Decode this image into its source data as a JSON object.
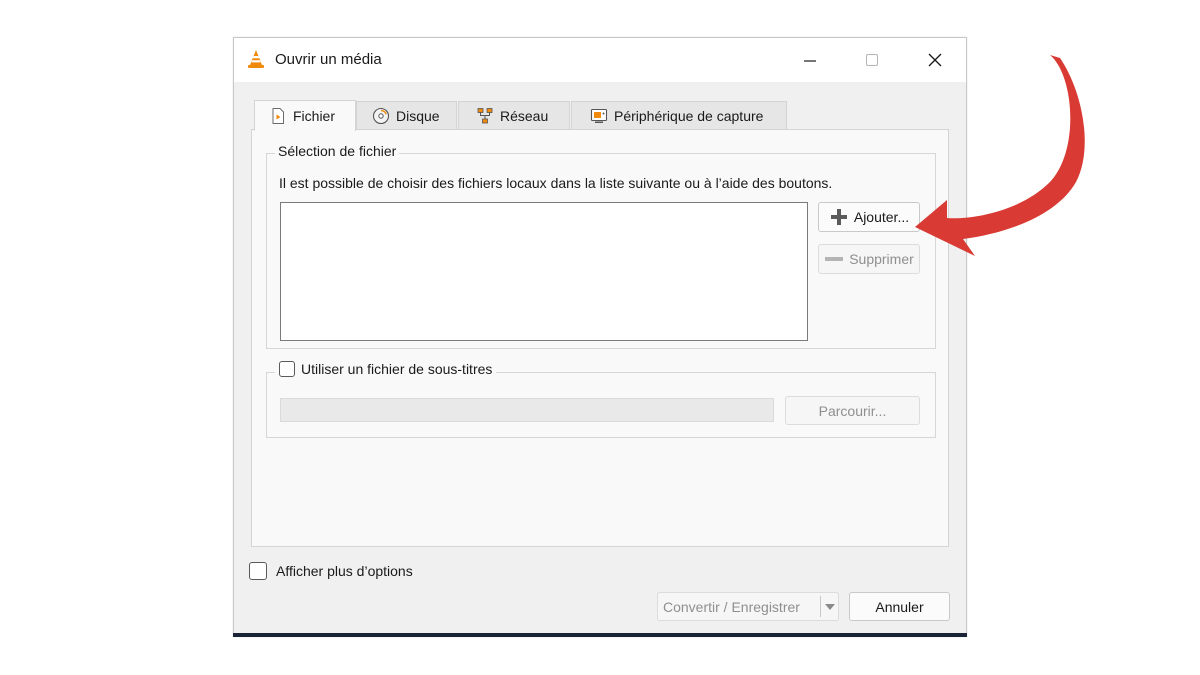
{
  "window": {
    "title": "Ouvrir un média",
    "minimize_symbol": "—",
    "maximize_symbol": "☐",
    "close_symbol": "✕"
  },
  "tabs": [
    {
      "label": "Fichier",
      "icon": "file-play-icon",
      "active": true
    },
    {
      "label": "Disque",
      "icon": "disc-icon",
      "active": false
    },
    {
      "label": "Réseau",
      "icon": "network-icon",
      "active": false
    },
    {
      "label": "Périphérique de capture",
      "icon": "capture-device-icon",
      "active": false
    }
  ],
  "file_selection": {
    "group_title": "Sélection de fichier",
    "description": "Il est possible de choisir des fichiers locaux dans la liste suivante ou à l’aide des boutons.",
    "add_label": "Ajouter...",
    "remove_label": "Supprimer"
  },
  "subtitles": {
    "checkbox_label": "Utiliser un fichier de sous-titres",
    "checked": false,
    "browse_label": "Parcourir..."
  },
  "footer": {
    "more_options_label": "Afficher plus d’options",
    "more_options_checked": false,
    "convert_label": "Convertir / Enregistrer",
    "cancel_label": "Annuler"
  },
  "annotation": {
    "arrow_color": "#d93a33",
    "points_to": "add-button"
  },
  "colors": {
    "accent_orange": "#f08a0c",
    "disabled_text": "#8f8f8f"
  }
}
